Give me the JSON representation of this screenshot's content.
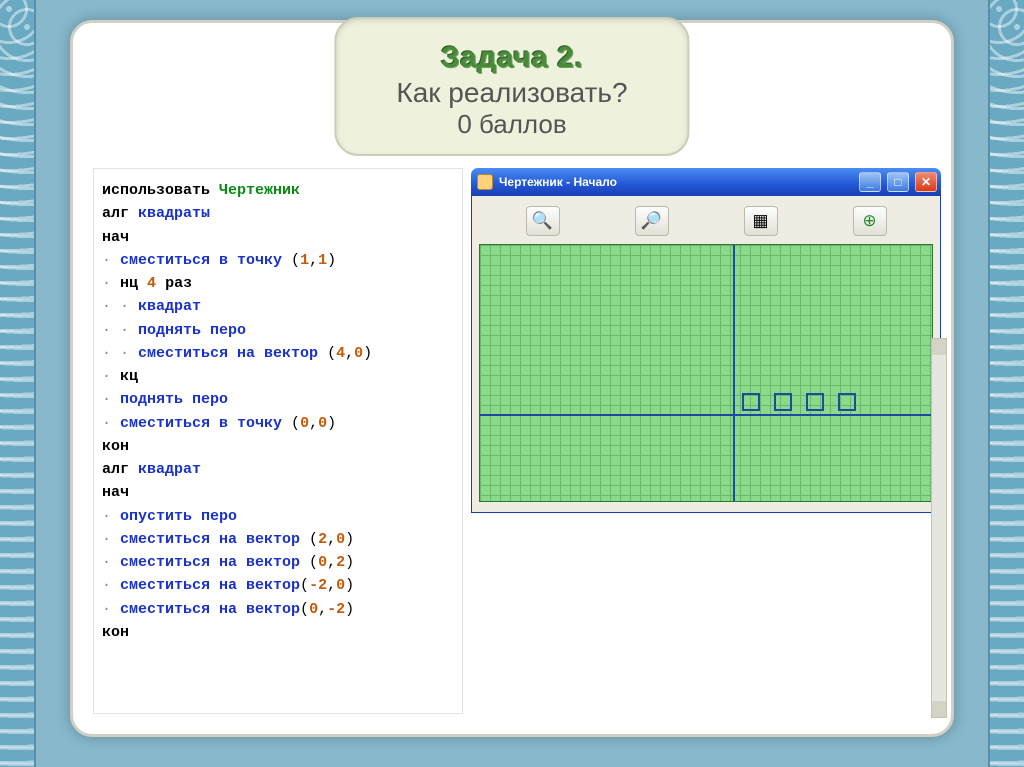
{
  "title": {
    "main": "Задача 2.",
    "question": "Как реализовать?",
    "score": "0 баллов"
  },
  "code": [
    {
      "t": "use",
      "parts": [
        "использовать",
        " ",
        "Чертежник"
      ]
    },
    {
      "t": "alg",
      "parts": [
        "алг",
        " ",
        "квадраты"
      ]
    },
    {
      "t": "kw",
      "parts": [
        "нач"
      ]
    },
    {
      "t": "cmd",
      "indent": 1,
      "parts": [
        "сместиться в точку",
        " (",
        "1",
        ",",
        "1",
        ")"
      ]
    },
    {
      "t": "loop",
      "indent": 1,
      "parts": [
        "нц",
        " ",
        "4",
        " ",
        "раз"
      ]
    },
    {
      "t": "call",
      "indent": 2,
      "parts": [
        "квадрат"
      ]
    },
    {
      "t": "call",
      "indent": 2,
      "parts": [
        "поднять перо"
      ]
    },
    {
      "t": "cmd",
      "indent": 2,
      "parts": [
        "сместиться на вектор",
        " (",
        "4",
        ",",
        "0",
        ")"
      ]
    },
    {
      "t": "kw",
      "indent": 1,
      "parts": [
        "кц"
      ]
    },
    {
      "t": "call",
      "indent": 1,
      "parts": [
        "поднять перо"
      ]
    },
    {
      "t": "cmd",
      "indent": 1,
      "parts": [
        "сместиться в точку",
        " (",
        "0",
        ",",
        "0",
        ")"
      ]
    },
    {
      "t": "kw",
      "parts": [
        "кон"
      ]
    },
    {
      "t": "alg",
      "parts": [
        "алг",
        " ",
        "квадрат"
      ]
    },
    {
      "t": "kw",
      "parts": [
        "нач"
      ]
    },
    {
      "t": "call",
      "indent": 1,
      "parts": [
        "опустить перо"
      ]
    },
    {
      "t": "cmd",
      "indent": 1,
      "parts": [
        "сместиться на вектор",
        " (",
        "2",
        ",",
        "0",
        ")"
      ]
    },
    {
      "t": "cmd",
      "indent": 1,
      "parts": [
        "сместиться на вектор",
        " (",
        "0",
        ",",
        "2",
        ")"
      ]
    },
    {
      "t": "cmd",
      "indent": 1,
      "parts": [
        "сместиться на вектор",
        "(",
        "-2",
        ",",
        "0",
        ")"
      ]
    },
    {
      "t": "cmd",
      "indent": 1,
      "parts": [
        "сместиться на вектор",
        "(",
        "0",
        ",",
        "-2",
        ")"
      ]
    },
    {
      "t": "kw",
      "parts": [
        "кон"
      ]
    }
  ],
  "drawer": {
    "window_title": "Чертежник - Начало",
    "toolbar_icons": [
      "zoom-in",
      "zoom-out",
      "grid",
      "zoom-fit"
    ]
  }
}
